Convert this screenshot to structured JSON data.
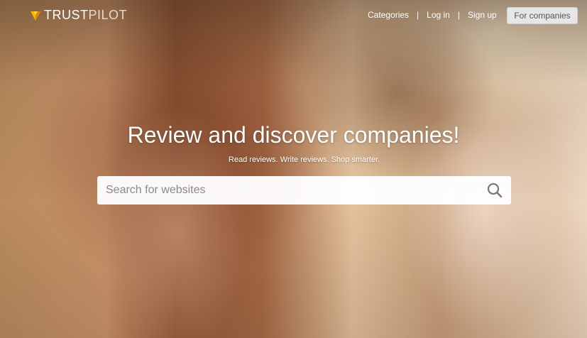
{
  "brand": {
    "name_bold": "TRUST",
    "name_light": "PILOT",
    "icon": "trustpilot-logo-icon",
    "accent_color": "#f5b900"
  },
  "nav": {
    "categories": "Categories",
    "log_in": "Log in",
    "sign_up": "Sign up",
    "separator": "|",
    "for_companies": "For companies"
  },
  "hero": {
    "headline": "Review and discover companies!",
    "subline": "Read reviews. Write reviews. Shop smarter."
  },
  "search": {
    "placeholder": "Search for websites",
    "value": "",
    "icon": "search-icon"
  }
}
